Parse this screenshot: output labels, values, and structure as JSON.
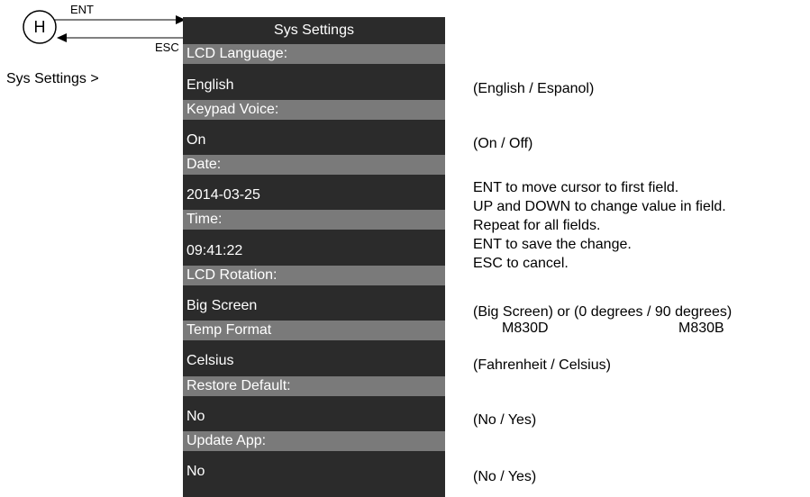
{
  "nav": {
    "home_key": "H",
    "ent_label": "ENT",
    "esc_label": "ESC",
    "breadcrumb": "Sys Settings >"
  },
  "menu": {
    "title": "Sys Settings",
    "rows": [
      {
        "label": "LCD Language:",
        "value": "English"
      },
      {
        "label": "Keypad Voice:",
        "value": "On"
      },
      {
        "label": "Date:",
        "value": "2014-03-25"
      },
      {
        "label": "Time:",
        "value": "09:41:22"
      },
      {
        "label": "LCD Rotation:",
        "value": "Big Screen"
      },
      {
        "label": "Temp Format",
        "value": "Celsius"
      },
      {
        "label": "Restore Default:",
        "value": "No"
      },
      {
        "label": "Update App:",
        "value": "No"
      }
    ]
  },
  "notes": {
    "language": "(English / Espanol)",
    "voice": "(On / Off)",
    "date_time": [
      "ENT to move cursor to first field.",
      "UP and DOWN to change value in field.",
      "Repeat for all fields.",
      "ENT to save the change.",
      "ESC to cancel."
    ],
    "rotation": "(Big Screen) or (0 degrees / 90 degrees)",
    "rotation_model_a": "M830D",
    "rotation_model_b": "M830B",
    "temp": "(Fahrenheit / Celsius)",
    "restore": "(No / Yes)",
    "update": "(No / Yes)"
  }
}
